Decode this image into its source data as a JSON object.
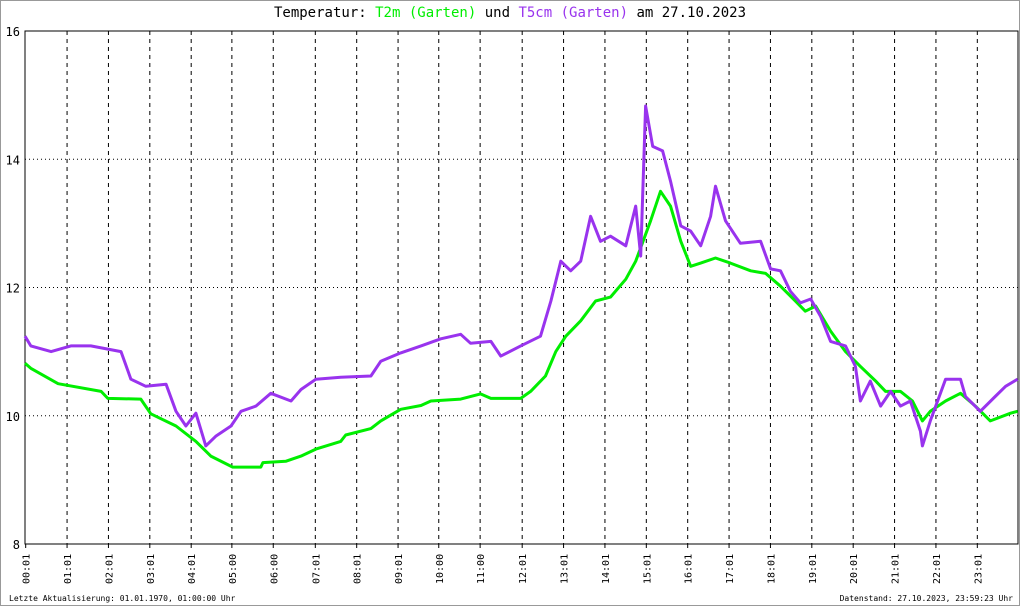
{
  "chart_data": {
    "type": "line",
    "title": {
      "prefix": "Temperatur: ",
      "s1": "T2m (Garten)",
      "mid": " und ",
      "s2": "T5cm (Garten)",
      "suffix": " am 27.10.2023"
    },
    "xlabel": "",
    "ylabel": "",
    "ylim": [
      8,
      16
    ],
    "xlim": [
      0,
      24
    ],
    "yticks": [
      "8",
      "10",
      "12",
      "14",
      "16"
    ],
    "xticks": [
      "00:01",
      "01:01",
      "02:01",
      "03:01",
      "04:01",
      "05:00",
      "06:00",
      "07:01",
      "08:01",
      "09:01",
      "10:00",
      "11:00",
      "12:01",
      "13:01",
      "14:01",
      "15:01",
      "16:01",
      "17:01",
      "18:01",
      "19:01",
      "20:01",
      "21:01",
      "22:01",
      "23:01"
    ],
    "grid": true,
    "series": [
      {
        "name": "T2m (Garten)",
        "color": "#00ee00",
        "points": [
          [
            0,
            10.82
          ],
          [
            0.14,
            10.74
          ],
          [
            0.8,
            10.5
          ],
          [
            1.84,
            10.38
          ],
          [
            2.0,
            10.27
          ],
          [
            2.8,
            10.26
          ],
          [
            3.04,
            10.03
          ],
          [
            3.65,
            9.84
          ],
          [
            4.13,
            9.6
          ],
          [
            4.49,
            9.37
          ],
          [
            5.02,
            9.2
          ],
          [
            5.7,
            9.2
          ],
          [
            5.75,
            9.27
          ],
          [
            6.3,
            9.29
          ],
          [
            6.67,
            9.37
          ],
          [
            7.03,
            9.48
          ],
          [
            7.63,
            9.6
          ],
          [
            7.75,
            9.7
          ],
          [
            8.36,
            9.8
          ],
          [
            8.6,
            9.92
          ],
          [
            9.08,
            10.1
          ],
          [
            9.57,
            10.16
          ],
          [
            9.81,
            10.23
          ],
          [
            10.53,
            10.26
          ],
          [
            11.01,
            10.34
          ],
          [
            11.26,
            10.27
          ],
          [
            11.98,
            10.27
          ],
          [
            12.22,
            10.38
          ],
          [
            12.58,
            10.62
          ],
          [
            12.83,
            11.0
          ],
          [
            13.07,
            11.24
          ],
          [
            13.43,
            11.48
          ],
          [
            13.79,
            11.79
          ],
          [
            14.15,
            11.85
          ],
          [
            14.52,
            12.13
          ],
          [
            14.76,
            12.41
          ],
          [
            15.12,
            13.04
          ],
          [
            15.36,
            13.5
          ],
          [
            15.6,
            13.27
          ],
          [
            15.85,
            12.72
          ],
          [
            16.09,
            12.33
          ],
          [
            16.33,
            12.38
          ],
          [
            16.69,
            12.46
          ],
          [
            17.05,
            12.38
          ],
          [
            17.54,
            12.26
          ],
          [
            17.9,
            12.22
          ],
          [
            18.26,
            12.02
          ],
          [
            18.62,
            11.79
          ],
          [
            18.86,
            11.63
          ],
          [
            19.11,
            11.71
          ],
          [
            19.47,
            11.32
          ],
          [
            19.83,
            11.0
          ],
          [
            20.19,
            10.77
          ],
          [
            20.56,
            10.54
          ],
          [
            20.8,
            10.38
          ],
          [
            21.16,
            10.38
          ],
          [
            21.45,
            10.23
          ],
          [
            21.69,
            9.92
          ],
          [
            21.88,
            10.07
          ],
          [
            22.25,
            10.23
          ],
          [
            22.61,
            10.35
          ],
          [
            22.97,
            10.15
          ],
          [
            23.33,
            9.92
          ],
          [
            23.82,
            10.04
          ],
          [
            23.99,
            10.07
          ]
        ]
      },
      {
        "name": "T5cm (Garten)",
        "color": "#9933ee",
        "points": [
          [
            0,
            11.24
          ],
          [
            0.14,
            11.09
          ],
          [
            0.63,
            11.0
          ],
          [
            1.11,
            11.09
          ],
          [
            1.59,
            11.09
          ],
          [
            2.32,
            11.0
          ],
          [
            2.56,
            10.57
          ],
          [
            2.92,
            10.46
          ],
          [
            3.41,
            10.49
          ],
          [
            3.65,
            10.07
          ],
          [
            3.89,
            9.84
          ],
          [
            4.13,
            10.04
          ],
          [
            4.37,
            9.53
          ],
          [
            4.61,
            9.68
          ],
          [
            4.98,
            9.84
          ],
          [
            5.22,
            10.07
          ],
          [
            5.58,
            10.15
          ],
          [
            5.94,
            10.35
          ],
          [
            6.43,
            10.23
          ],
          [
            6.67,
            10.41
          ],
          [
            7.03,
            10.57
          ],
          [
            7.63,
            10.6
          ],
          [
            8.36,
            10.62
          ],
          [
            8.6,
            10.85
          ],
          [
            9.08,
            10.98
          ],
          [
            9.57,
            11.09
          ],
          [
            10.05,
            11.2
          ],
          [
            10.53,
            11.27
          ],
          [
            10.77,
            11.13
          ],
          [
            11.26,
            11.16
          ],
          [
            11.5,
            10.93
          ],
          [
            11.98,
            11.09
          ],
          [
            12.46,
            11.24
          ],
          [
            12.71,
            11.79
          ],
          [
            12.95,
            12.41
          ],
          [
            13.19,
            12.26
          ],
          [
            13.43,
            12.41
          ],
          [
            13.67,
            13.11
          ],
          [
            13.91,
            12.72
          ],
          [
            14.15,
            12.8
          ],
          [
            14.52,
            12.65
          ],
          [
            14.76,
            13.27
          ],
          [
            14.88,
            12.49
          ],
          [
            15.0,
            14.83
          ],
          [
            15.17,
            14.2
          ],
          [
            15.41,
            14.13
          ],
          [
            15.6,
            13.66
          ],
          [
            15.85,
            12.96
          ],
          [
            16.09,
            12.88
          ],
          [
            16.33,
            12.65
          ],
          [
            16.57,
            13.11
          ],
          [
            16.69,
            13.58
          ],
          [
            16.93,
            13.04
          ],
          [
            17.29,
            12.69
          ],
          [
            17.78,
            12.72
          ],
          [
            18.02,
            12.29
          ],
          [
            18.26,
            12.26
          ],
          [
            18.5,
            11.94
          ],
          [
            18.74,
            11.76
          ],
          [
            18.99,
            11.82
          ],
          [
            19.23,
            11.55
          ],
          [
            19.47,
            11.16
          ],
          [
            19.83,
            11.09
          ],
          [
            20.07,
            10.77
          ],
          [
            20.19,
            10.23
          ],
          [
            20.43,
            10.54
          ],
          [
            20.68,
            10.15
          ],
          [
            20.92,
            10.38
          ],
          [
            21.16,
            10.15
          ],
          [
            21.4,
            10.23
          ],
          [
            21.64,
            9.76
          ],
          [
            21.69,
            9.53
          ],
          [
            21.88,
            9.92
          ],
          [
            22.25,
            10.57
          ],
          [
            22.61,
            10.57
          ],
          [
            22.73,
            10.3
          ],
          [
            23.09,
            10.07
          ],
          [
            23.45,
            10.3
          ],
          [
            23.7,
            10.46
          ],
          [
            23.99,
            10.57
          ]
        ]
      }
    ]
  },
  "footer": {
    "left": "Letzte Aktualisierung: 01.01.1970, 01:00:00 Uhr",
    "right": "Datenstand: 27.10.2023, 23:59:23 Uhr"
  }
}
